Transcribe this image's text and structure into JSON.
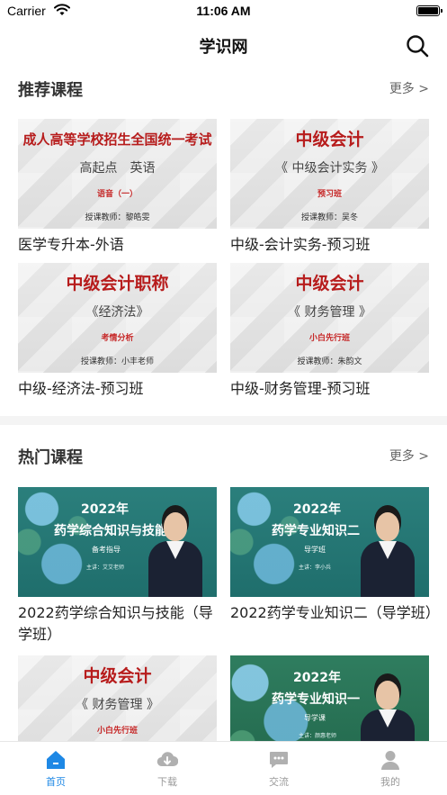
{
  "status_bar": {
    "carrier": "Carrier",
    "time": "11:06 AM"
  },
  "nav": {
    "title": "学识网"
  },
  "recommended": {
    "title": "推荐课程",
    "more": "更多 >",
    "courses": [
      {
        "label": "医学专升本-外语",
        "thumb": {
          "main": "成人高等学校招生全国统一考试",
          "sub": "高起点　英语",
          "tag": "语音（一）",
          "teacher": "授课教师：黎皓雯"
        }
      },
      {
        "label": "中级-会计实务-预习班",
        "thumb": {
          "main": "中级会计",
          "sub": "《 中级会计实务 》",
          "tag": "预习班",
          "teacher": "授课教师：吴冬"
        }
      },
      {
        "label": "中级-经济法-预习班",
        "thumb": {
          "main": "中级会计职称",
          "sub": "《经济法》",
          "tag": "考情分析",
          "teacher": "授课教师：小丰老师"
        }
      },
      {
        "label": "中级-财务管理-预习班",
        "thumb": {
          "main": "中级会计",
          "sub": "《 财务管理 》",
          "tag": "小白先行班",
          "teacher": "授课教师：朱韵文"
        }
      }
    ]
  },
  "hot": {
    "title": "热门课程",
    "more": "更多 >",
    "courses": [
      {
        "label": "2022药学综合知识与技能（导学班）",
        "thumb": {
          "year": "2022年",
          "main": "药学综合知识与技能",
          "tag": "备考指导",
          "teacher": "主讲：艾艾老师"
        }
      },
      {
        "label": "2022药学专业知识二（导学班）",
        "thumb": {
          "year": "2022年",
          "main": "药学专业知识二",
          "tag": "导学班",
          "teacher": "主讲：李小兵"
        }
      },
      {
        "label": "",
        "thumb": {
          "main": "中级会计",
          "sub": "《 财务管理 》",
          "tag": "小白先行班"
        }
      },
      {
        "label": "",
        "thumb": {
          "year": "2022年",
          "main": "药学专业知识一",
          "tag": "导学课",
          "teacher": "主讲：颜惠老师"
        }
      }
    ]
  },
  "tab_bar": {
    "tabs": [
      {
        "label": "首页",
        "icon": "home-icon",
        "active": true
      },
      {
        "label": "下载",
        "icon": "download-icon",
        "active": false
      },
      {
        "label": "交流",
        "icon": "chat-icon",
        "active": false
      },
      {
        "label": "我的",
        "icon": "profile-icon",
        "active": false
      }
    ]
  },
  "colors": {
    "accent": "#1e88e5",
    "title_red": "#b71c1c",
    "inactive_tab": "#999999"
  }
}
